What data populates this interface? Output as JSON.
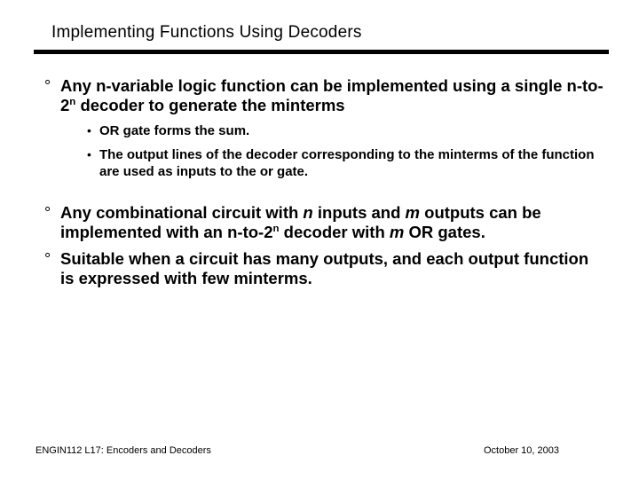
{
  "title": "Implementing Functions Using Decoders",
  "bullets": {
    "b1_pre": "Any n-variable logic function can be implemented using a single n-to-2",
    "b1_sup": "n",
    "b1_post": " decoder to generate the minterms",
    "b1a": "OR gate forms the sum.",
    "b1b": "The output lines of the decoder corresponding to the minterms of the function are used as inputs to the or gate.",
    "b2_a": "Any combinational circuit with ",
    "b2_n": "n",
    "b2_b": " inputs and ",
    "b2_m": "m",
    "b2_c": " outputs can be implemented with an n-to-2",
    "b2_sup": "n",
    "b2_d": " decoder with ",
    "b2_m2": "m",
    "b2_e": " OR gates.",
    "b3": "Suitable when a circuit has many outputs, and each output function is expressed with few minterms."
  },
  "footer": {
    "left": "ENGIN112 L17: Encoders and Decoders",
    "right": "October 10, 2003"
  }
}
